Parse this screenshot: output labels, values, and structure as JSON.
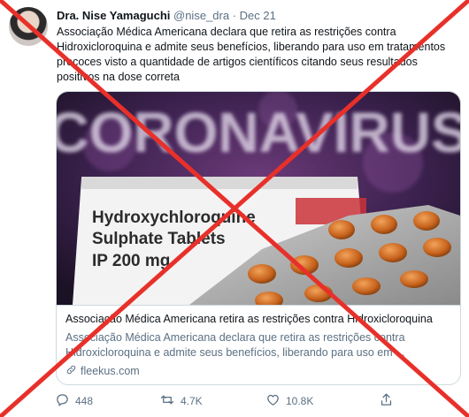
{
  "tweet": {
    "author_name": "Dra. Nise Yamaguchi",
    "handle": "@nise_dra",
    "separator": "·",
    "date": "Dec 21",
    "text": "Associação Médica Americana declara que retira as restrições contra Hidroxicloroquina e admite seus benefícios, liberando para uso em tratamentos precoces visto a quantidade de artigos científicos citando seus resultados positivos na dose correta"
  },
  "card": {
    "media": {
      "background_word": "CORONAVIRUS",
      "box_line1": "Hydroxychloroquine",
      "box_line2": "Sulphate Tablets",
      "box_line3": "IP 200 mg"
    },
    "title": "Associação Médica Americana retira as restrições contra Hidroxicloroquina",
    "description": "Associação Médica Americana declara que retira as restrições contra Hidroxicloroquina e admite seus benefícios, liberando para uso em ...",
    "link": "fleekus.com"
  },
  "actions": {
    "replies": "448",
    "retweets": "4.7K",
    "likes": "10.8K"
  },
  "overlay": {
    "color": "#e8302a"
  },
  "icons": [
    "reply-icon",
    "retweet-icon",
    "like-icon",
    "share-icon",
    "link-icon"
  ]
}
